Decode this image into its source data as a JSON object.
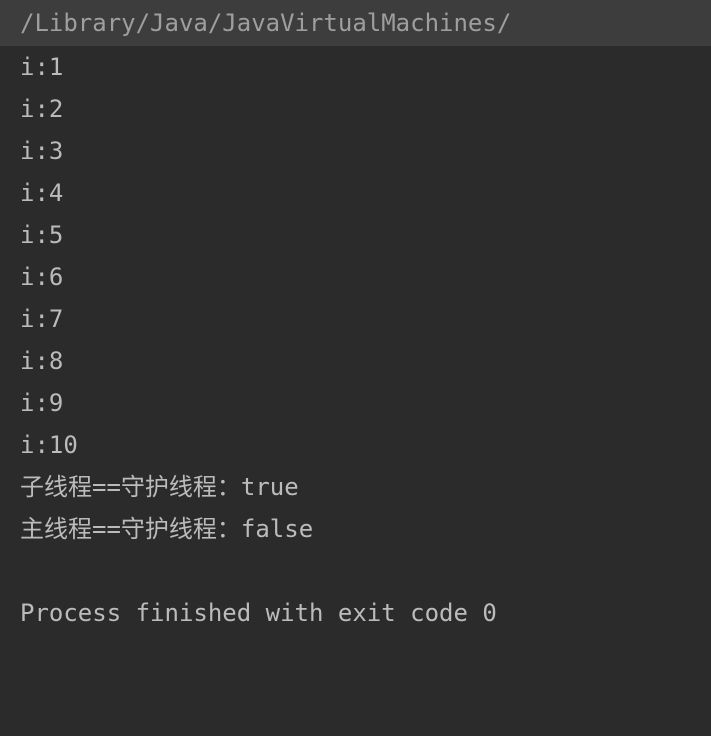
{
  "console": {
    "path": "/Library/Java/JavaVirtualMachines/",
    "lines": [
      "i:1",
      "i:2",
      "i:3",
      "i:4",
      "i:5",
      "i:6",
      "i:7",
      "i:8",
      "i:9",
      "i:10",
      "子线程==守护线程：true",
      "主线程==守护线程：false"
    ],
    "exit_message": "Process finished with exit code 0"
  }
}
